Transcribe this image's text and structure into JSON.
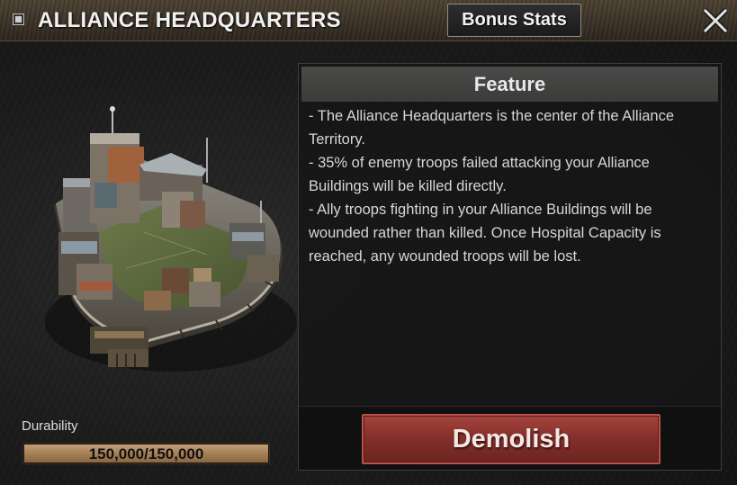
{
  "header": {
    "title": "ALLIANCE HEADQUARTERS",
    "bonus_button": "Bonus Stats",
    "close_icon": "close-x-icon",
    "bullet_icon": "square-bullet-icon"
  },
  "building": {
    "icon": "alliance-headquarters-building"
  },
  "durability": {
    "label": "Durability",
    "value_text": "150,000/150,000",
    "current": 150000,
    "max": 150000
  },
  "feature": {
    "heading": "Feature",
    "lines": [
      "- The Alliance Headquarters is the center of the Alliance Territory.",
      "- 35% of enemy troops failed attacking your Alliance Buildings will be killed directly.",
      "- Ally troops fighting in your Alliance Buildings will be wounded rather than killed. Once Hospital Capacity is reached, any wounded troops will be lost."
    ]
  },
  "actions": {
    "demolish_label": "Demolish"
  },
  "colors": {
    "demolish": "#85302b",
    "durability_fill": "#a47f57",
    "header": "#3a3126"
  }
}
